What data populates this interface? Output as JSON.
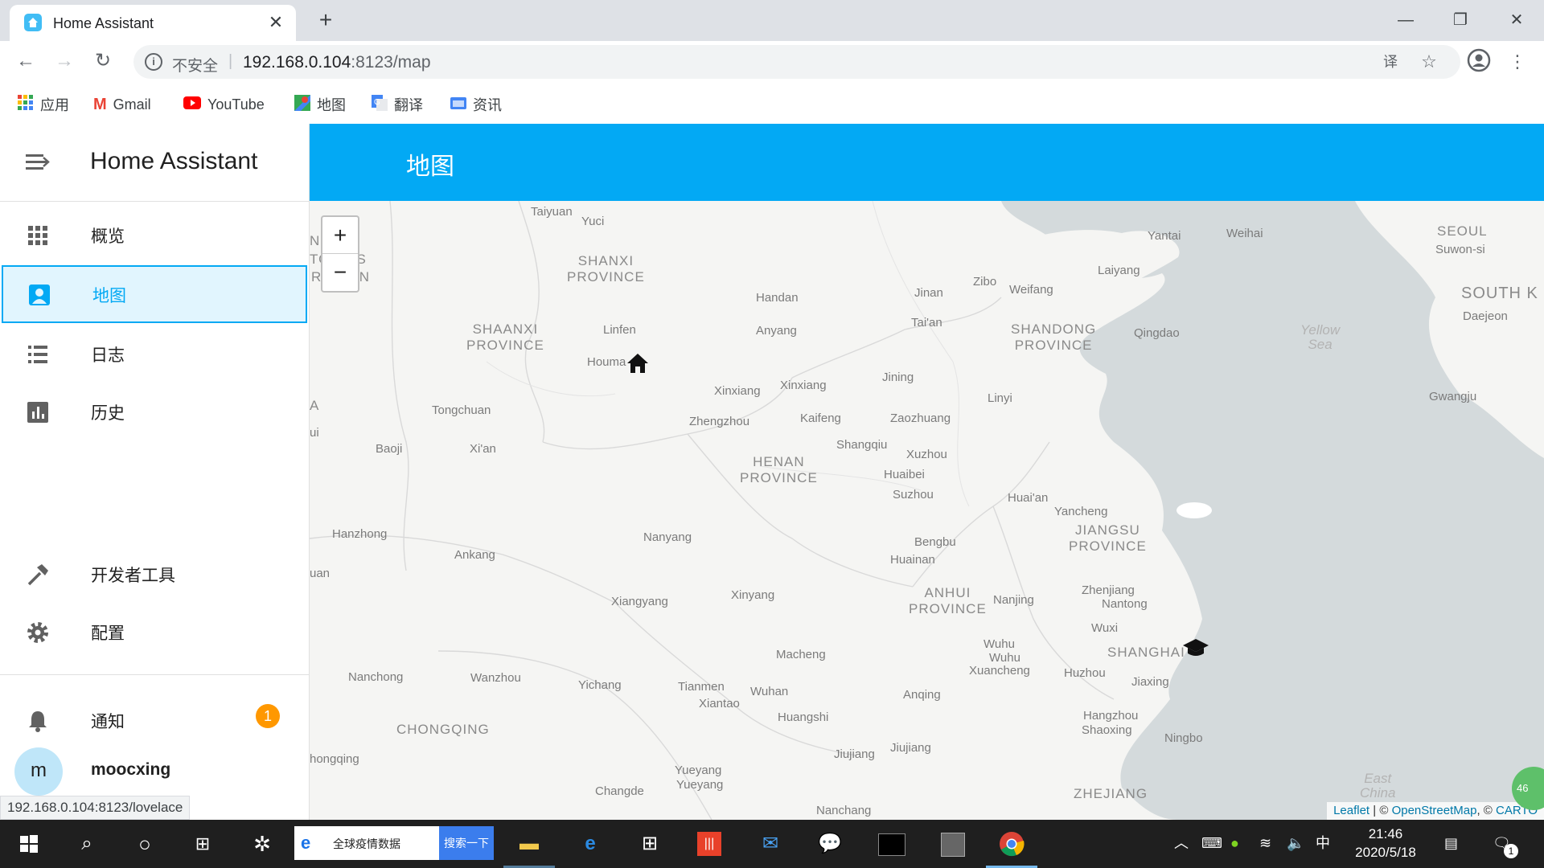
{
  "browser": {
    "tab_title": "Home Assistant",
    "tab_close": "✕",
    "new_tab": "+",
    "insecure_label": "不安全",
    "url_host": "192.168.0.104",
    "url_rest": ":8123/map",
    "bookmarks": [
      "应用",
      "Gmail",
      "YouTube",
      "地图",
      "翻译",
      "资讯"
    ],
    "status_url": "192.168.0.104:8123/lovelace"
  },
  "sidebar": {
    "title": "Home Assistant",
    "items": [
      {
        "label": "概览",
        "icon": "apps-grid-icon"
      },
      {
        "label": "地图",
        "icon": "account-box-icon",
        "active": true
      },
      {
        "label": "日志",
        "icon": "format-list-icon"
      },
      {
        "label": "历史",
        "icon": "chart-box-icon"
      }
    ],
    "dev_tools": "开发者工具",
    "config": "配置",
    "notifications": "通知",
    "notifications_count": "1",
    "user_initial": "m",
    "user_name": "moocxing"
  },
  "header": {
    "title": "地图"
  },
  "map": {
    "zoom_in": "+",
    "zoom_out": "−",
    "attribution": {
      "leaflet": "Leaflet",
      "sep1": " | © ",
      "osm": "OpenStreetMap",
      "sep2": ", © ",
      "carto": "CARTO"
    },
    "peek": "46",
    "labels": {
      "taiyuan": "Taiyuan",
      "yuci": "Yuci",
      "shanxi": "SHANXI\nPROVINCE",
      "shaanxi": "SHAANXI\nPROVINCE",
      "henan": "HENAN\nPROVINCE",
      "shandong": "SHANDONG\nPROVINCE",
      "jiangsu": "JIANGSU\nPROVINCE",
      "anhui": "ANHUI\nPROVINCE",
      "chongqing": "CHONGQING",
      "zhejiang": "ZHEJIANG",
      "shanghai": "SHANGHAI",
      "seoul": "SEOUL",
      "suwon": "Suwon-si",
      "south_k": "SOUTH K",
      "daejeon": "Daejeon",
      "gwangju": "Gwangju",
      "yellow_sea": "Yellow\nSea",
      "east_china": "East\nChina",
      "yantai": "Yantai",
      "weihai": "Weihai",
      "laiyang": "Laiyang",
      "zibo": "Zibo",
      "weifang": "Weifang",
      "jinan": "Jinan",
      "taian": "Tai'an",
      "qingdao": "Qingdao",
      "handan": "Handan",
      "anyang": "Anyang",
      "linfen": "Linfen",
      "houma": "Houma",
      "xinxiang1": "Xinxiang",
      "xinxiang2": "Xinxiang",
      "jining": "Jining",
      "linyi": "Linyi",
      "tongchuan": "Tongchuan",
      "zhengzhou": "Zhengzhou",
      "kaifeng": "Kaifeng",
      "zaozhuang": "Zaozhuang",
      "shangqiu": "Shangqiu",
      "xuzhou": "Xuzhou",
      "baoji": "Baoji",
      "xian": "Xi'an",
      "huaibei": "Huaibei",
      "suzhou": "Suzhou",
      "huaian": "Huai'an",
      "yancheng": "Yancheng",
      "hanzhong": "Hanzhong",
      "nanyang": "Nanyang",
      "bengbu": "Bengbu",
      "ankang": "Ankang",
      "huainan": "Huainan",
      "xiangyang": "Xiangyang",
      "xinyang": "Xinyang",
      "nanjing": "Nanjing",
      "zhenjiang": "Zhenjiang",
      "nantong": "Nantong",
      "wuxi": "Wuxi",
      "macheng": "Macheng",
      "wuhu1": "Wuhu",
      "wuhu2": "Wuhu",
      "xuancheng": "Xuancheng",
      "huzhou": "Huzhou",
      "jiaxing": "Jiaxing",
      "nanchong": "Nanchong",
      "wanzhou": "Wanzhou",
      "yichang": "Yichang",
      "tianmen": "Tianmen",
      "wuhan": "Wuhan",
      "xiantao": "Xiantao",
      "anqing": "Anqing",
      "huangshi": "Huangshi",
      "hangzhou": "Hangzhou",
      "shaoxing": "Shaoxing",
      "ningbo": "Ningbo",
      "chongqing_city": "hongqing",
      "jiujiang1": "Jiujiang",
      "jiujiang2": "Jiujiang",
      "yueyang1": "Yueyang",
      "yueyang2": "Yueyang",
      "changde": "Changde",
      "nanchang": "Nanchang",
      "yuan": "uan",
      "ui": "ui",
      "region_left": "REGION",
      "tous": "TO    OUS",
      "ni": "N    A",
      "a": "A"
    }
  },
  "taskbar": {
    "search_text": "全球疫情数据",
    "search_button": "搜索一下",
    "time": "21:46",
    "date": "2020/5/18",
    "ime": "中",
    "action_count": "1"
  },
  "colors": {
    "accent": "#03a9f4",
    "badge": "#ff9800",
    "active_bg": "#e1f5fe"
  }
}
